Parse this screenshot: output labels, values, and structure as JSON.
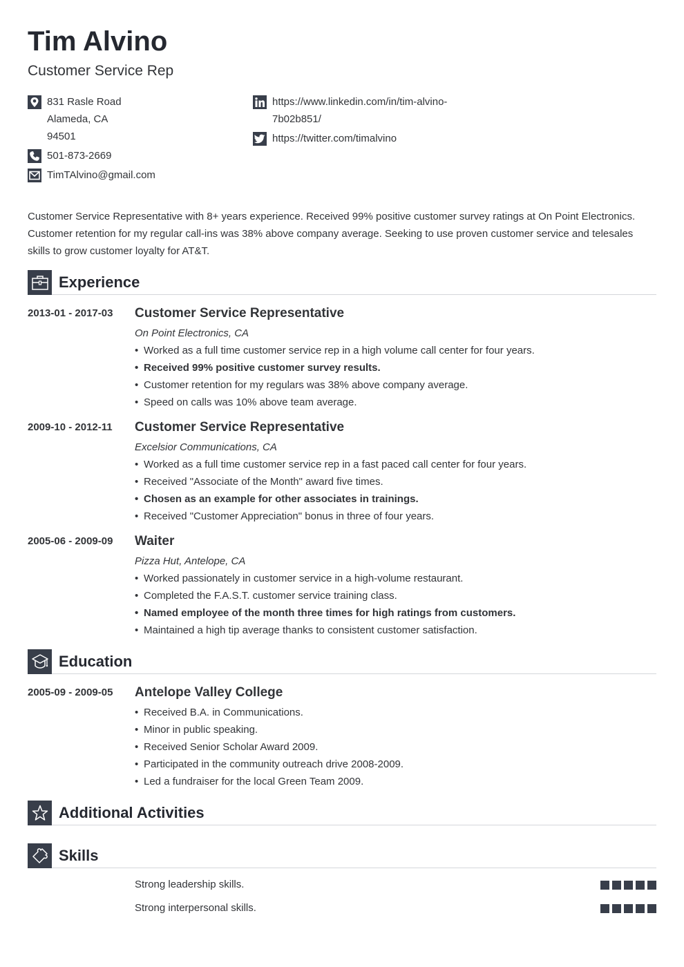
{
  "header": {
    "name": "Tim Alvino",
    "title": "Customer Service Rep"
  },
  "contact": {
    "address": {
      "icon": "map-pin-icon",
      "lines": [
        "831 Rasle Road",
        "Alameda, CA",
        "94501"
      ]
    },
    "phone": {
      "icon": "phone-icon",
      "value": "501-873-2669"
    },
    "email": {
      "icon": "envelope-icon",
      "value": "TimTAlvino@gmail.com"
    },
    "linkedin": {
      "icon": "linkedin-icon",
      "lines": [
        "https://www.linkedin.com/in/tim-alvino-",
        "7b02b851/"
      ]
    },
    "twitter": {
      "icon": "twitter-icon",
      "value": "https://twitter.com/timalvino"
    }
  },
  "summary": "Customer Service Representative with 8+ years experience. Received 99% positive customer survey ratings at On Point Electronics. Customer retention for my regular call-ins was 38% above company average. Seeking to use proven customer service and telesales skills to grow customer loyalty for AT&T.",
  "sections": {
    "experience": {
      "title": "Experience",
      "icon": "briefcase-icon"
    },
    "education": {
      "title": "Education",
      "icon": "graduation-cap-icon"
    },
    "activities": {
      "title": "Additional Activities",
      "icon": "star-icon"
    },
    "skills": {
      "title": "Skills",
      "icon": "puzzle-icon"
    }
  },
  "experience": [
    {
      "dates": "2013-01 - 2017-03",
      "title": "Customer Service Representative",
      "org": "On Point Electronics, CA",
      "bullets": [
        {
          "text": "Worked as a full time customer service rep in a high volume call center for four years.",
          "bold": false
        },
        {
          "text": "Received 99% positive customer survey results.",
          "bold": true
        },
        {
          "text": "Customer retention for my regulars was 38% above company average.",
          "bold": false
        },
        {
          "text": "Speed on calls was 10% above team average.",
          "bold": false
        }
      ]
    },
    {
      "dates": "2009-10 - 2012-11",
      "title": "Customer Service Representative",
      "org": "Excelsior Communications, CA",
      "bullets": [
        {
          "text": "Worked as a full time customer service rep in a fast paced call center for four years.",
          "bold": false
        },
        {
          "text": "Received \"Associate of the Month\" award five times.",
          "bold": false
        },
        {
          "text": "Chosen as an example for other associates in trainings.",
          "bold": true
        },
        {
          "text": "Received \"Customer Appreciation\" bonus in three of four years.",
          "bold": false
        }
      ]
    },
    {
      "dates": "2005-06 - 2009-09",
      "title": "Waiter",
      "org": "Pizza Hut, Antelope, CA",
      "bullets": [
        {
          "text": "Worked passionately in customer service in a high-volume restaurant.",
          "bold": false
        },
        {
          "text": "Completed the F.A.S.T. customer service training class.",
          "bold": false
        },
        {
          "text": "Named employee of the month three times for high ratings from customers.",
          "bold": true
        },
        {
          "text": "Maintained a high tip average thanks to consistent customer satisfaction.",
          "bold": false
        }
      ]
    }
  ],
  "education": [
    {
      "dates": "2005-09 - 2009-05",
      "title": "Antelope Valley College",
      "bullets": [
        {
          "text": "Received B.A. in Communications.",
          "bold": false
        },
        {
          "text": "Minor in public speaking.",
          "bold": false
        },
        {
          "text": "Received Senior Scholar Award 2009.",
          "bold": false
        },
        {
          "text": "Participated in the community outreach drive 2008-2009.",
          "bold": false
        },
        {
          "text": "Led a fundraiser for the local Green Team 2009.",
          "bold": false
        }
      ]
    }
  ],
  "skills": [
    {
      "name": "Strong leadership skills.",
      "level": 5,
      "max": 5
    },
    {
      "name": "Strong interpersonal skills.",
      "level": 5,
      "max": 5
    }
  ],
  "colors": {
    "accent": "#383e4a",
    "text": "#323438",
    "heading": "#252830",
    "rule": "#d4d6da"
  }
}
